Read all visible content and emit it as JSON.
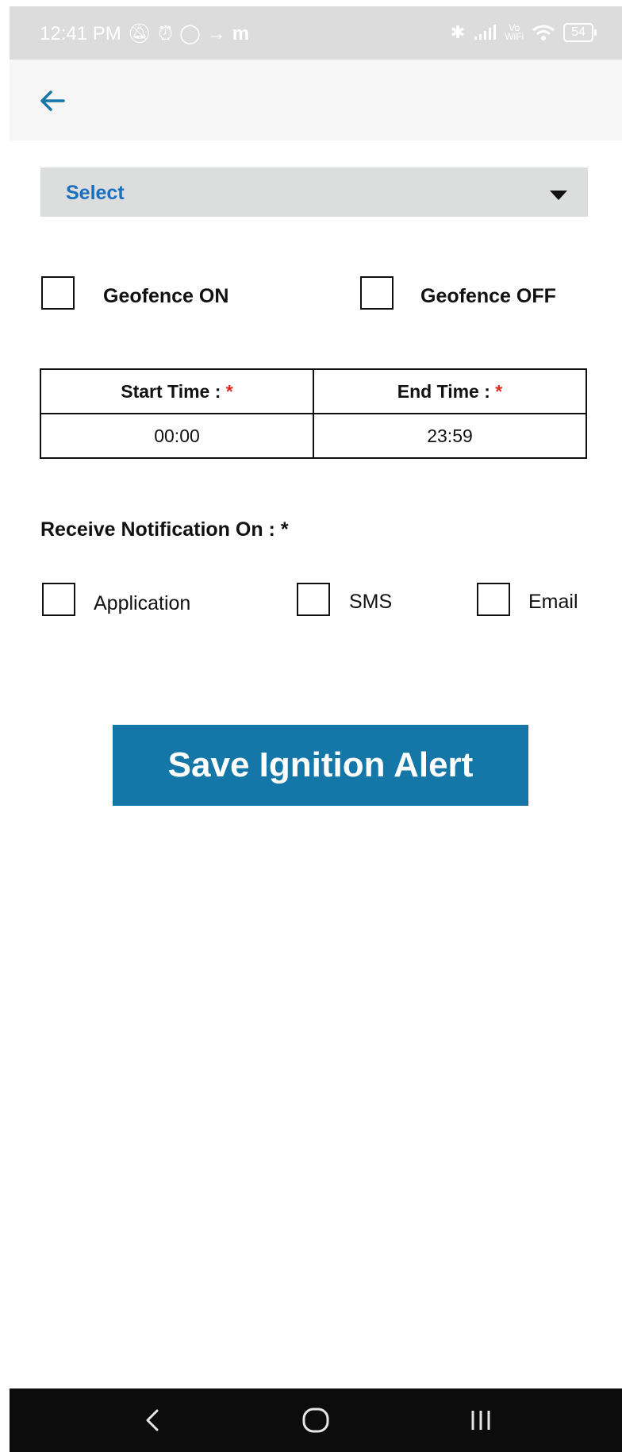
{
  "status_bar": {
    "time": "12:41 PM",
    "left_icons": [
      "muted-icon",
      "alarm-icon",
      "whatsapp-icon",
      "arrow-icon",
      "m-app-icon"
    ],
    "right_icons": [
      "bluetooth-icon",
      "signal-icon",
      "vowifi-icon",
      "wifi-icon"
    ],
    "vowifi_top": "Vo",
    "vowifi_bottom": "WiFi",
    "battery": "54"
  },
  "app_bar": {
    "back_icon": "arrow-left-icon"
  },
  "dropdown": {
    "selected": "Select"
  },
  "geofence": {
    "on_label": "Geofence ON",
    "off_label": "Geofence OFF"
  },
  "time_table": {
    "start_label": "Start Time :",
    "end_label": "End Time :",
    "required_mark": "*",
    "start_value": "00:00",
    "end_value": "23:59"
  },
  "notification": {
    "title": "Receive Notification On : *",
    "options": [
      "Application",
      "SMS",
      "Email"
    ]
  },
  "save_button": {
    "label": "Save Ignition Alert"
  },
  "colors": {
    "accent": "#1576a8",
    "select_text": "#1a6fc0",
    "required": "#e0281f",
    "status_bar": "#dcdcdc",
    "nav_bar": "#0c0c0c"
  }
}
